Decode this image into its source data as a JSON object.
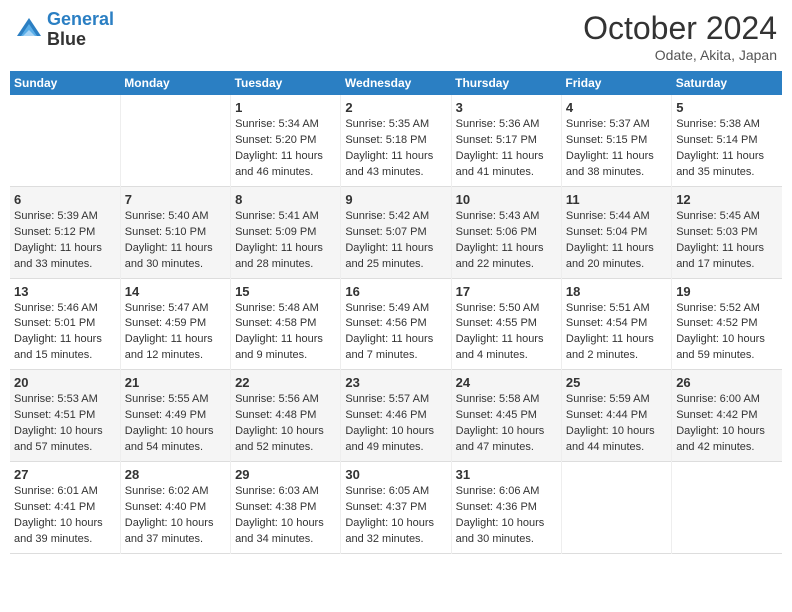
{
  "header": {
    "logo_line1": "General",
    "logo_line2": "Blue",
    "month_title": "October 2024",
    "subtitle": "Odate, Akita, Japan"
  },
  "days_of_week": [
    "Sunday",
    "Monday",
    "Tuesday",
    "Wednesday",
    "Thursday",
    "Friday",
    "Saturday"
  ],
  "weeks": [
    [
      {
        "day": "",
        "info": ""
      },
      {
        "day": "",
        "info": ""
      },
      {
        "day": "1",
        "info": "Sunrise: 5:34 AM\nSunset: 5:20 PM\nDaylight: 11 hours and 46 minutes."
      },
      {
        "day": "2",
        "info": "Sunrise: 5:35 AM\nSunset: 5:18 PM\nDaylight: 11 hours and 43 minutes."
      },
      {
        "day": "3",
        "info": "Sunrise: 5:36 AM\nSunset: 5:17 PM\nDaylight: 11 hours and 41 minutes."
      },
      {
        "day": "4",
        "info": "Sunrise: 5:37 AM\nSunset: 5:15 PM\nDaylight: 11 hours and 38 minutes."
      },
      {
        "day": "5",
        "info": "Sunrise: 5:38 AM\nSunset: 5:14 PM\nDaylight: 11 hours and 35 minutes."
      }
    ],
    [
      {
        "day": "6",
        "info": "Sunrise: 5:39 AM\nSunset: 5:12 PM\nDaylight: 11 hours and 33 minutes."
      },
      {
        "day": "7",
        "info": "Sunrise: 5:40 AM\nSunset: 5:10 PM\nDaylight: 11 hours and 30 minutes."
      },
      {
        "day": "8",
        "info": "Sunrise: 5:41 AM\nSunset: 5:09 PM\nDaylight: 11 hours and 28 minutes."
      },
      {
        "day": "9",
        "info": "Sunrise: 5:42 AM\nSunset: 5:07 PM\nDaylight: 11 hours and 25 minutes."
      },
      {
        "day": "10",
        "info": "Sunrise: 5:43 AM\nSunset: 5:06 PM\nDaylight: 11 hours and 22 minutes."
      },
      {
        "day": "11",
        "info": "Sunrise: 5:44 AM\nSunset: 5:04 PM\nDaylight: 11 hours and 20 minutes."
      },
      {
        "day": "12",
        "info": "Sunrise: 5:45 AM\nSunset: 5:03 PM\nDaylight: 11 hours and 17 minutes."
      }
    ],
    [
      {
        "day": "13",
        "info": "Sunrise: 5:46 AM\nSunset: 5:01 PM\nDaylight: 11 hours and 15 minutes."
      },
      {
        "day": "14",
        "info": "Sunrise: 5:47 AM\nSunset: 4:59 PM\nDaylight: 11 hours and 12 minutes."
      },
      {
        "day": "15",
        "info": "Sunrise: 5:48 AM\nSunset: 4:58 PM\nDaylight: 11 hours and 9 minutes."
      },
      {
        "day": "16",
        "info": "Sunrise: 5:49 AM\nSunset: 4:56 PM\nDaylight: 11 hours and 7 minutes."
      },
      {
        "day": "17",
        "info": "Sunrise: 5:50 AM\nSunset: 4:55 PM\nDaylight: 11 hours and 4 minutes."
      },
      {
        "day": "18",
        "info": "Sunrise: 5:51 AM\nSunset: 4:54 PM\nDaylight: 11 hours and 2 minutes."
      },
      {
        "day": "19",
        "info": "Sunrise: 5:52 AM\nSunset: 4:52 PM\nDaylight: 10 hours and 59 minutes."
      }
    ],
    [
      {
        "day": "20",
        "info": "Sunrise: 5:53 AM\nSunset: 4:51 PM\nDaylight: 10 hours and 57 minutes."
      },
      {
        "day": "21",
        "info": "Sunrise: 5:55 AM\nSunset: 4:49 PM\nDaylight: 10 hours and 54 minutes."
      },
      {
        "day": "22",
        "info": "Sunrise: 5:56 AM\nSunset: 4:48 PM\nDaylight: 10 hours and 52 minutes."
      },
      {
        "day": "23",
        "info": "Sunrise: 5:57 AM\nSunset: 4:46 PM\nDaylight: 10 hours and 49 minutes."
      },
      {
        "day": "24",
        "info": "Sunrise: 5:58 AM\nSunset: 4:45 PM\nDaylight: 10 hours and 47 minutes."
      },
      {
        "day": "25",
        "info": "Sunrise: 5:59 AM\nSunset: 4:44 PM\nDaylight: 10 hours and 44 minutes."
      },
      {
        "day": "26",
        "info": "Sunrise: 6:00 AM\nSunset: 4:42 PM\nDaylight: 10 hours and 42 minutes."
      }
    ],
    [
      {
        "day": "27",
        "info": "Sunrise: 6:01 AM\nSunset: 4:41 PM\nDaylight: 10 hours and 39 minutes."
      },
      {
        "day": "28",
        "info": "Sunrise: 6:02 AM\nSunset: 4:40 PM\nDaylight: 10 hours and 37 minutes."
      },
      {
        "day": "29",
        "info": "Sunrise: 6:03 AM\nSunset: 4:38 PM\nDaylight: 10 hours and 34 minutes."
      },
      {
        "day": "30",
        "info": "Sunrise: 6:05 AM\nSunset: 4:37 PM\nDaylight: 10 hours and 32 minutes."
      },
      {
        "day": "31",
        "info": "Sunrise: 6:06 AM\nSunset: 4:36 PM\nDaylight: 10 hours and 30 minutes."
      },
      {
        "day": "",
        "info": ""
      },
      {
        "day": "",
        "info": ""
      }
    ]
  ]
}
